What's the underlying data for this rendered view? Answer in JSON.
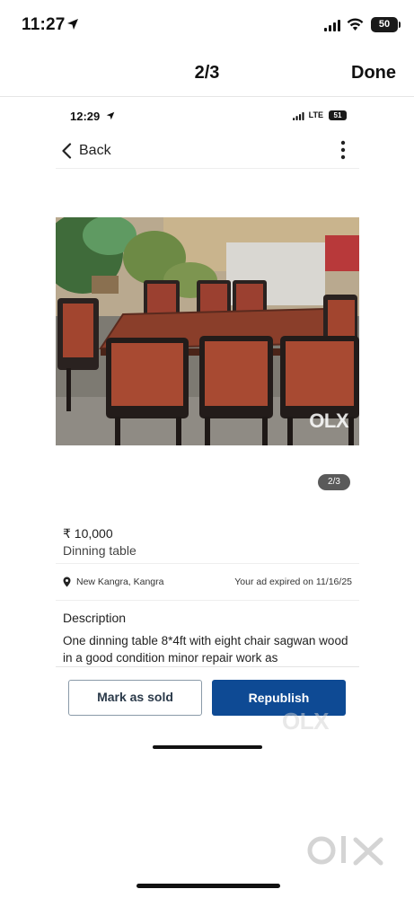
{
  "status_bar": {
    "time": "11:27",
    "battery": "50"
  },
  "viewer": {
    "counter": "2/3",
    "done_label": "Done"
  },
  "screenshot": {
    "status_bar": {
      "time": "12:29",
      "network": "LTE",
      "battery": "51"
    },
    "nav": {
      "back_label": "Back"
    },
    "photo": {
      "watermark": "OLX",
      "pager": "2/3"
    },
    "listing": {
      "price": "₹ 10,000",
      "title": "Dinning table",
      "location": "New Kangra, Kangra",
      "expiry": "Your ad expired on 11/16/25",
      "description_heading": "Description",
      "description": "One dinning table 8*4ft with eight chair sagwan wood in a good condition minor repair work as"
    },
    "actions": {
      "mark_sold_label": "Mark as sold",
      "republish_label": "Republish"
    },
    "watermark": "OLX"
  },
  "bottom_watermark": "OLX",
  "colors": {
    "primary_button": "#0e4a94",
    "outline_button_border": "#8a9aa8",
    "pager_badge": "#5a5a5a"
  }
}
